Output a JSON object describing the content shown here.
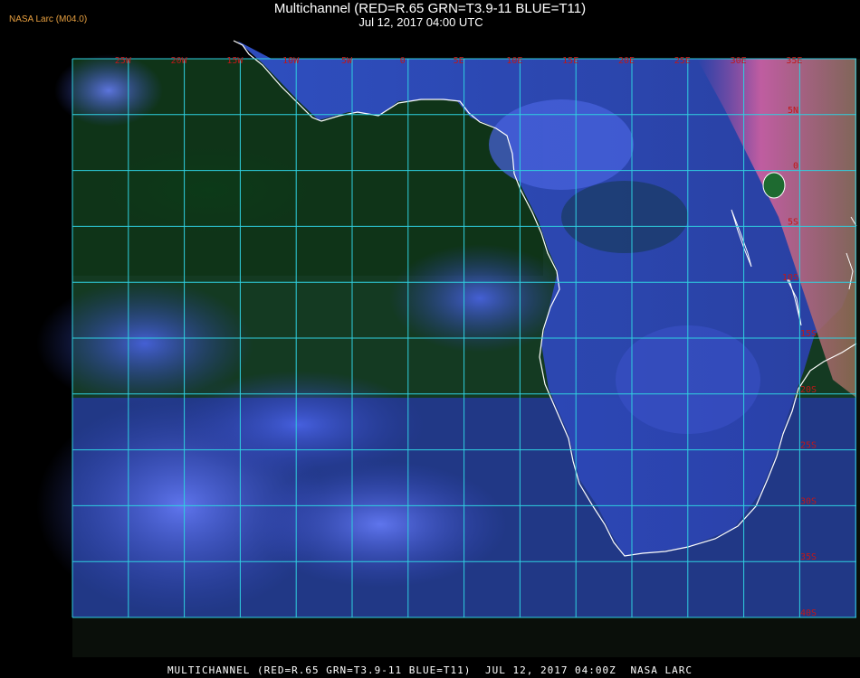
{
  "header": {
    "credit": "NASA Larc (M04.0)",
    "title": "Multichannel (RED=R.65 GRN=T3.9-11 BLUE=T11)",
    "subtitle": "Jul 12, 2017 04:00 UTC"
  },
  "map": {
    "lon_labels": [
      "25W",
      "20W",
      "15W",
      "10W",
      "5W",
      "0",
      "5E",
      "10E",
      "15E",
      "20E",
      "25E",
      "30E",
      "35E"
    ],
    "lat_labels": [
      "5N",
      "0",
      "5S",
      "10S",
      "15S",
      "20S",
      "25S",
      "30S",
      "35S",
      "40S"
    ],
    "grid_color": "#2fd0e0",
    "coast_color": "#ffffff",
    "label_color": "#c01818"
  },
  "footer": {
    "product": "MULTICHANNEL (RED=R.65 GRN=T3.9-11 BLUE=T11)",
    "datetime": "JUL 12, 2017 04:00Z",
    "org": "NASA LARC"
  }
}
